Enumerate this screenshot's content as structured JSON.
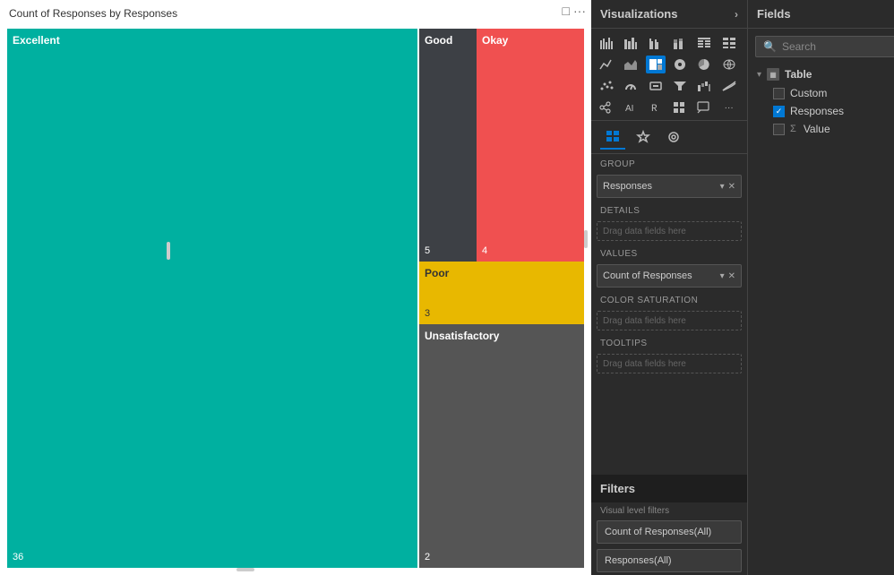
{
  "chart": {
    "title": "Count of Responses by Responses",
    "treemap": {
      "excellent": {
        "label": "Excellent",
        "value": "36",
        "color": "#00b0a0"
      },
      "good": {
        "label": "Good",
        "value": "5",
        "color": "#3d4045"
      },
      "okay": {
        "label": "Okay",
        "value": "4",
        "color": "#f05050"
      },
      "poor": {
        "label": "Poor",
        "value": "3",
        "color": "#e8b800"
      },
      "unsatisfactory": {
        "label": "Unsatisfactory",
        "value": "2",
        "color": "#555555"
      }
    }
  },
  "visualizations": {
    "header": "Visualizations",
    "chevron": "›",
    "tabs": [
      {
        "label": "⊞",
        "tooltip": "Fields"
      },
      {
        "label": "⚙",
        "tooltip": "Format"
      },
      {
        "label": "🔍",
        "tooltip": "Analytics"
      }
    ],
    "sections": {
      "group": "Group",
      "details": "Details",
      "values": "Values",
      "color_saturation": "Color saturation",
      "tooltips": "Tooltips"
    },
    "group_field": "Responses",
    "values_field": "Count of Responses",
    "drag_placeholder": "Drag data fields here"
  },
  "fields": {
    "header": "Fields",
    "chevron": "›",
    "search_placeholder": "Search",
    "table_label": "Table",
    "items": [
      {
        "name": "Custom",
        "checked": false,
        "type": "text"
      },
      {
        "name": "Responses",
        "checked": true,
        "type": "text"
      },
      {
        "name": "Value",
        "checked": false,
        "type": "sigma"
      }
    ]
  },
  "filters": {
    "header": "Filters",
    "section_label": "Visual level filters",
    "items": [
      {
        "label": "Count of Responses(All)"
      },
      {
        "label": "Responses(All)"
      }
    ]
  }
}
